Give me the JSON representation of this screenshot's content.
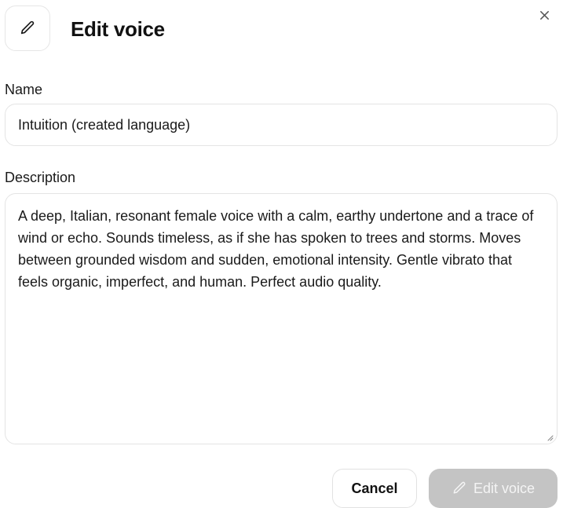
{
  "dialog": {
    "title": "Edit voice",
    "header_icon": "pencil-icon",
    "close_icon": "close-icon"
  },
  "name_field": {
    "label": "Name",
    "value": "Intuition (created language)"
  },
  "description_field": {
    "label": "Description",
    "value": "A deep, Italian, resonant female voice with a calm, earthy undertone and a trace of wind or echo. Sounds timeless, as if she has spoken to trees and storms. Moves between grounded wisdom and sudden, emotional intensity. Gentle vibrato that feels organic, imperfect, and human. Perfect audio quality."
  },
  "footer": {
    "cancel_label": "Cancel",
    "submit_label": "Edit voice",
    "submit_icon": "pencil-icon",
    "submit_disabled": true
  },
  "colors": {
    "border": "#e4e4e4",
    "disabled_button_bg": "#c4c4c4",
    "disabled_button_text": "#f4f4f4",
    "text": "#111111"
  }
}
